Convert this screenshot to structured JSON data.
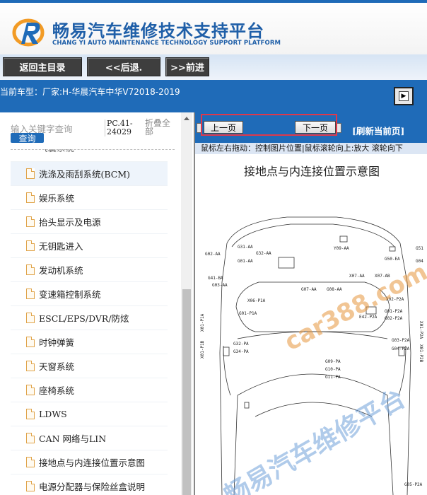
{
  "header": {
    "title": "畅易汽车维修技术支持平台",
    "subtitle": "CHANG YI AUTO MAINTENANCE TECHNOLOGY SUPPORT PLATFORM"
  },
  "nav": {
    "home": "返回主目录",
    "back": "<<后退.",
    "forward": ">>前进"
  },
  "vehicle": {
    "text": "当前车型：厂家:H-华晨汽车中华V72018-2019"
  },
  "sidebar": {
    "search_placeholder": "输入关键字查询",
    "search_button": "查询",
    "code": "PC.41-24029",
    "fold_all": "折叠全部",
    "items": [
      {
        "label": "气囊系统"
      },
      {
        "label": "洗涤及雨刮系统(BCM)"
      },
      {
        "label": "娱乐系统"
      },
      {
        "label": "抬头显示及电源"
      },
      {
        "label": "无钥匙进入"
      },
      {
        "label": "发动机系统"
      },
      {
        "label": "变速箱控制系统"
      },
      {
        "label": "ESCL/EPS/DVR/防炫"
      },
      {
        "label": "时钟弹簧"
      },
      {
        "label": "天窗系统"
      },
      {
        "label": "座椅系统"
      },
      {
        "label": "LDWS"
      },
      {
        "label": "CAN 网络与LIN"
      },
      {
        "label": "接地点与内连接位置示意图"
      },
      {
        "label": "电源分配器与保险丝盒说明"
      }
    ]
  },
  "main": {
    "prev": "上一页",
    "next": "下一页",
    "refresh": "[刷新当前页]",
    "hint": "鼠标左右拖动：控制图片位置|鼠标滚轮向上:放大  滚轮向下",
    "diagram_title": "接地点与内连接位置示意图",
    "watermark_url": "car388.com",
    "watermark_cn": "畅易汽车维修平台",
    "labels": {
      "y09": "Y09-AA",
      "g31": "G31-AA",
      "g32": "G32-AA",
      "g01aa": "G01-AA",
      "g02": "G02-AA",
      "g41": "G41-BA",
      "g03": "G03-AA",
      "g50": "G50-EA",
      "g51": "G51",
      "g04": "G04",
      "x07": "X07-AA",
      "x07b": "X07-AB",
      "g07": "G07-AA",
      "g08": "G08-AA",
      "x06": "X06-P1A",
      "x01p1a": "X01-P1A",
      "x01p1b": "X01-P1B",
      "g01p1a": "G01-P1A",
      "g02p2a": "G02-P2A",
      "g01p2a": "G01-P2A",
      "x02": "X02-P2A",
      "x01p2a": "X01-P2A",
      "x01p2b": "X01-P2B",
      "g32pa": "G32-PA",
      "g34pa": "G34-PA",
      "g09": "G09-PA",
      "g10": "G10-PA",
      "g11": "G11-PA",
      "g03p2a": "G03-P2A",
      "g04p2a": "G04-P2A",
      "g05": "G05-P2A",
      "e42": "E42-P2A"
    }
  },
  "colors": {
    "brand_blue": "#1f6bb8",
    "highlight_red": "#e0384a",
    "watermark_blue": "#6fa0d8"
  }
}
